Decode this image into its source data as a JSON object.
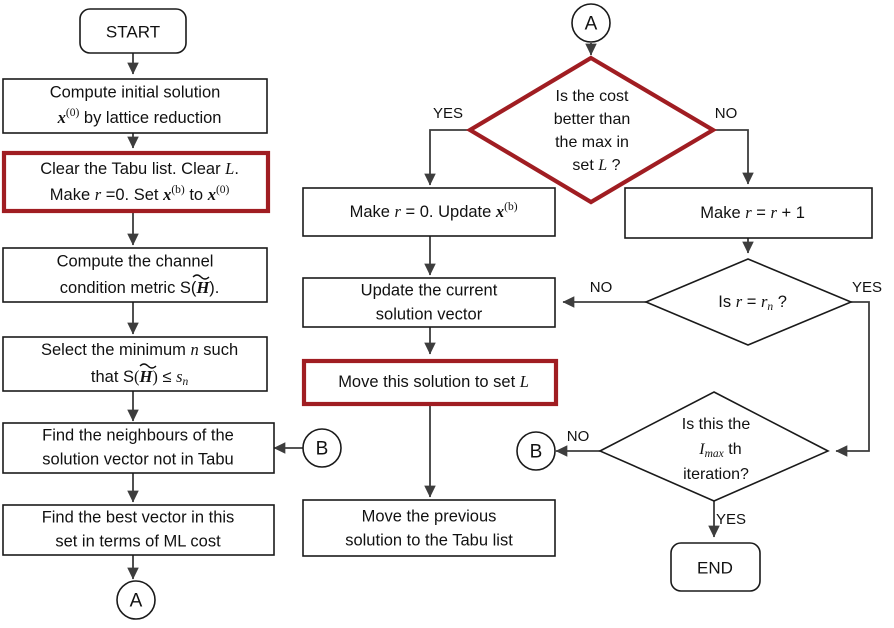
{
  "diagram": {
    "title": "Tabu search with lattice reduction flowchart",
    "accent_highlight_color": "#a01d22",
    "line_color": "#3d3d3d",
    "box_border_color": "#1a1a1a",
    "background_color": "#ffffff"
  },
  "terminators": {
    "start": "START",
    "end": "END"
  },
  "connectors": {
    "a_top": "A",
    "a_bottom": "A",
    "b_left": "B",
    "b_right": "B"
  },
  "left_column": {
    "compute_initial": {
      "line1": "Compute initial solution",
      "line2_pre": "",
      "line2_var": "x",
      "line2_sup": "(0)",
      "line2_post": " by lattice reduction",
      "highlighted": false
    },
    "clear_tabu": {
      "line1": "Clear the Tabu list. Clear ",
      "line1_var": "L",
      "line1_end": ".",
      "line2_pre": "Make ",
      "line2_var": "r",
      "line2_mid": " =0. Set ",
      "line2_var2": "x",
      "line2_sup2": "(b)",
      "line2_to": " to ",
      "line2_var3": "x",
      "line2_sup3": "(0)",
      "highlighted": true
    },
    "channel_metric": {
      "line1": "Compute the channel",
      "line2_pre": "condition metric S(",
      "line2_var": "H",
      "line2_post": ").",
      "highlighted": false
    },
    "select_min_n": {
      "line1_pre": "Select the minimum ",
      "line1_var": "n",
      "line1_post": " such",
      "line2_pre": "that S",
      "line2_var": "H",
      "line2_rel": " ≤ ",
      "line2_var2": "s",
      "line2_sub2": "n",
      "highlighted": false
    },
    "find_neighbours": {
      "line1": "Find the neighbours of the",
      "line2": "solution vector not in Tabu",
      "highlighted": false
    },
    "find_best": {
      "line1": "Find the best vector in this",
      "line2": "set in terms of ML cost",
      "highlighted": false
    }
  },
  "middle_column": {
    "make_r0": {
      "pre": "Make ",
      "var": "r",
      "mid": " = 0. Update ",
      "var2": "x",
      "sup2": "(b)",
      "highlighted": false
    },
    "update_current": {
      "line1": "Update the current",
      "line2": "solution vector",
      "highlighted": false
    },
    "move_to_set_l": {
      "pre": "Move this solution to set ",
      "var": "L",
      "highlighted": true
    },
    "move_previous": {
      "line1": "Move the previous",
      "line2": "solution to the Tabu list",
      "highlighted": false
    }
  },
  "right_column": {
    "cost_decision": {
      "line1": "Is the cost",
      "line2": "better than",
      "line3": "the max in",
      "line4_pre": "set ",
      "line4_var": "L",
      "line4_post": " ?",
      "highlighted": true
    },
    "make_r_plus_1": {
      "pre": "Make ",
      "var": "r",
      "mid": " = ",
      "var2": "r",
      "post": " + 1",
      "highlighted": false
    },
    "r_equals_rn": {
      "pre": "Is ",
      "var": "r",
      "mid": " = ",
      "var2": "r",
      "sub2": "n",
      "post": " ?",
      "highlighted": false
    },
    "imax_decision": {
      "line1": "Is this the",
      "line2_var": "I",
      "line2_sub": "max",
      "line2_post": " th",
      "line3": "iteration?",
      "highlighted": false
    }
  },
  "edge_labels": {
    "cost_yes": "YES",
    "cost_no": "NO",
    "rn_no": "NO",
    "rn_yes": "YES",
    "imax_no": "NO",
    "imax_yes": "YES"
  }
}
